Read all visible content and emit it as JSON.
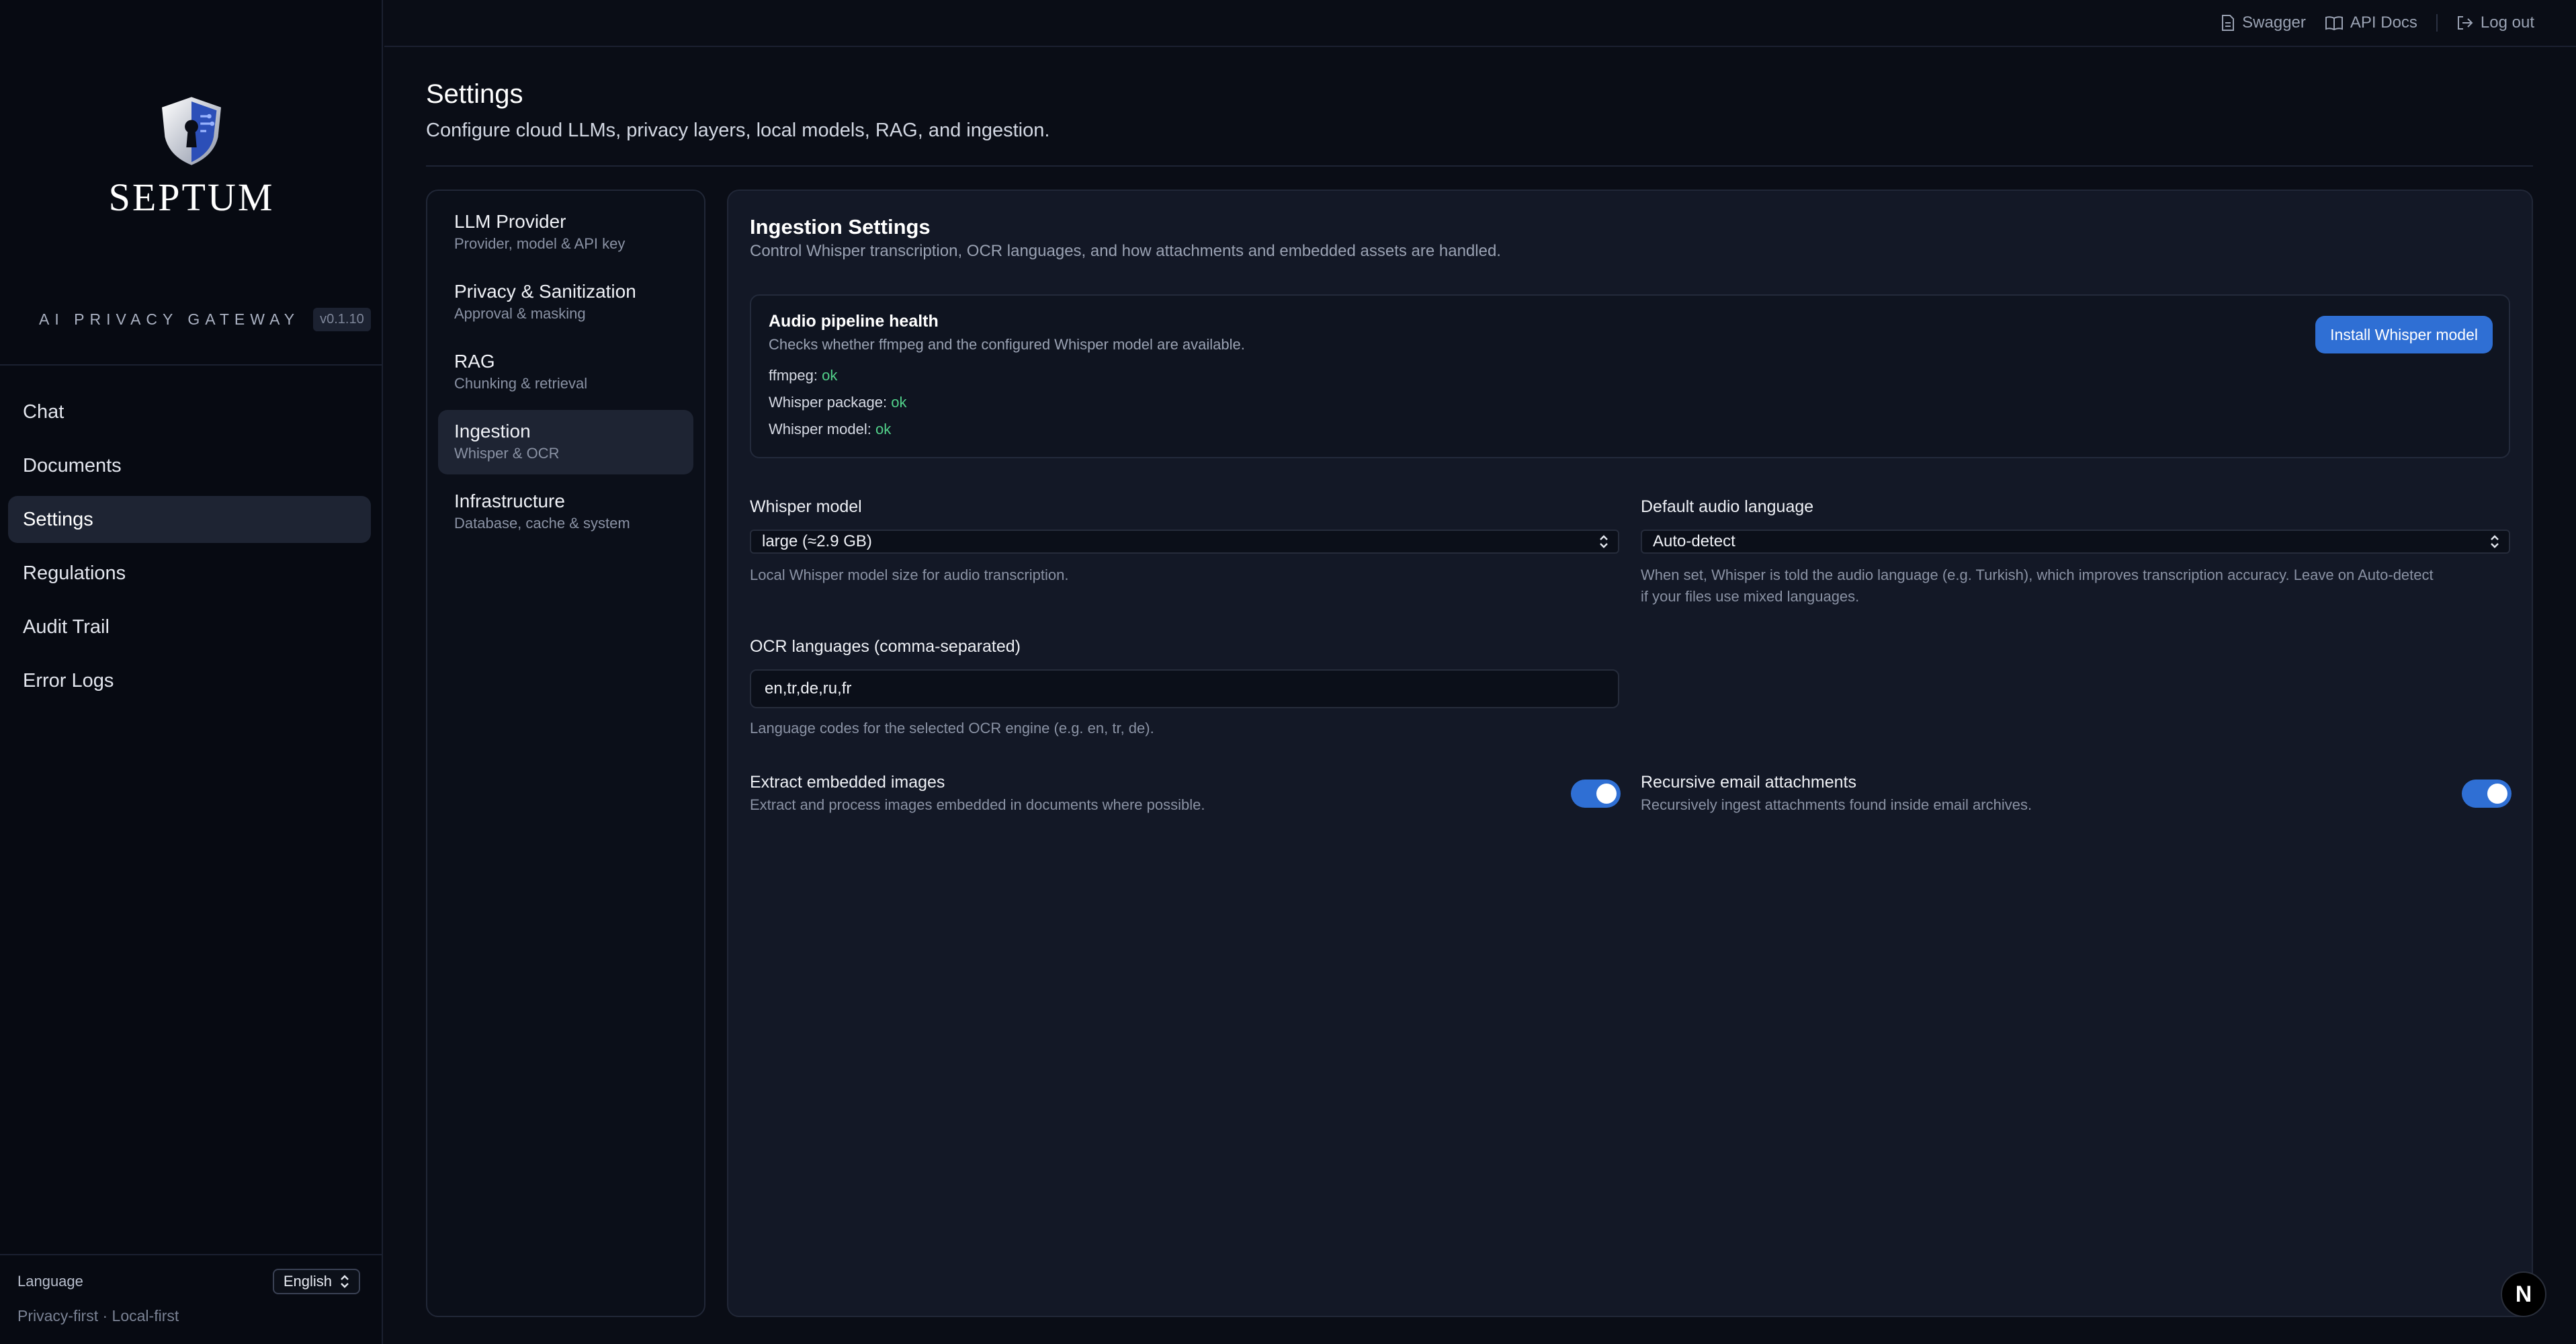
{
  "brand": {
    "name": "SEPTUM",
    "tagline": "AI PRIVACY GATEWAY",
    "version": "v0.1.10",
    "accent": "#2f6fd4"
  },
  "nav": {
    "items": [
      {
        "label": "Chat"
      },
      {
        "label": "Documents"
      },
      {
        "label": "Settings",
        "active": true
      },
      {
        "label": "Regulations"
      },
      {
        "label": "Audit Trail"
      },
      {
        "label": "Error Logs"
      }
    ]
  },
  "sidebar_footer": {
    "language_label": "Language",
    "language_value": "English",
    "tagline": "Privacy-first · Local-first"
  },
  "topbar": {
    "swagger": "Swagger",
    "api_docs": "API Docs",
    "logout": "Log out"
  },
  "page": {
    "title": "Settings",
    "subtitle": "Configure cloud LLMs, privacy layers, local models, RAG, and ingestion."
  },
  "subnav": {
    "items": [
      {
        "title": "LLM Provider",
        "desc": "Provider, model & API key"
      },
      {
        "title": "Privacy & Sanitization",
        "desc": "Approval & masking"
      },
      {
        "title": "RAG",
        "desc": "Chunking & retrieval"
      },
      {
        "title": "Ingestion",
        "desc": "Whisper & OCR",
        "active": true
      },
      {
        "title": "Infrastructure",
        "desc": "Database, cache & system"
      }
    ]
  },
  "ingestion": {
    "title": "Ingestion Settings",
    "description": "Control Whisper transcription, OCR languages, and how attachments and embedded assets are handled.",
    "health": {
      "title": "Audio pipeline health",
      "description": "Checks whether ffmpeg and the configured Whisper model are available.",
      "ffmpeg_label": "ffmpeg:",
      "ffmpeg_value": "ok",
      "package_label": "Whisper package:",
      "package_value": "ok",
      "model_label": "Whisper model:",
      "model_value": "ok",
      "install_button": "Install Whisper model"
    },
    "whisper_model": {
      "label": "Whisper model",
      "value": "large (≈2.9 GB)",
      "help": "Local Whisper model size for audio transcription."
    },
    "audio_language": {
      "label": "Default audio language",
      "value": "Auto-detect",
      "help_line1": "When set, Whisper is told the audio language (e.g. Turkish), which improves transcription accuracy. Leave on Auto-detect",
      "help_line2": "if your files use mixed languages."
    },
    "ocr": {
      "label": "OCR languages (comma-separated)",
      "value": "en,tr,de,ru,fr",
      "help": "Language codes for the selected OCR engine (e.g. en, tr, de)."
    },
    "extract_images": {
      "label": "Extract embedded images",
      "help": "Extract and process images embedded in documents where possible.",
      "enabled": true
    },
    "recursive_attachments": {
      "label": "Recursive email attachments",
      "help": "Recursively ingest attachments found inside email archives.",
      "enabled": true
    }
  },
  "badge": {
    "letter": "N"
  }
}
